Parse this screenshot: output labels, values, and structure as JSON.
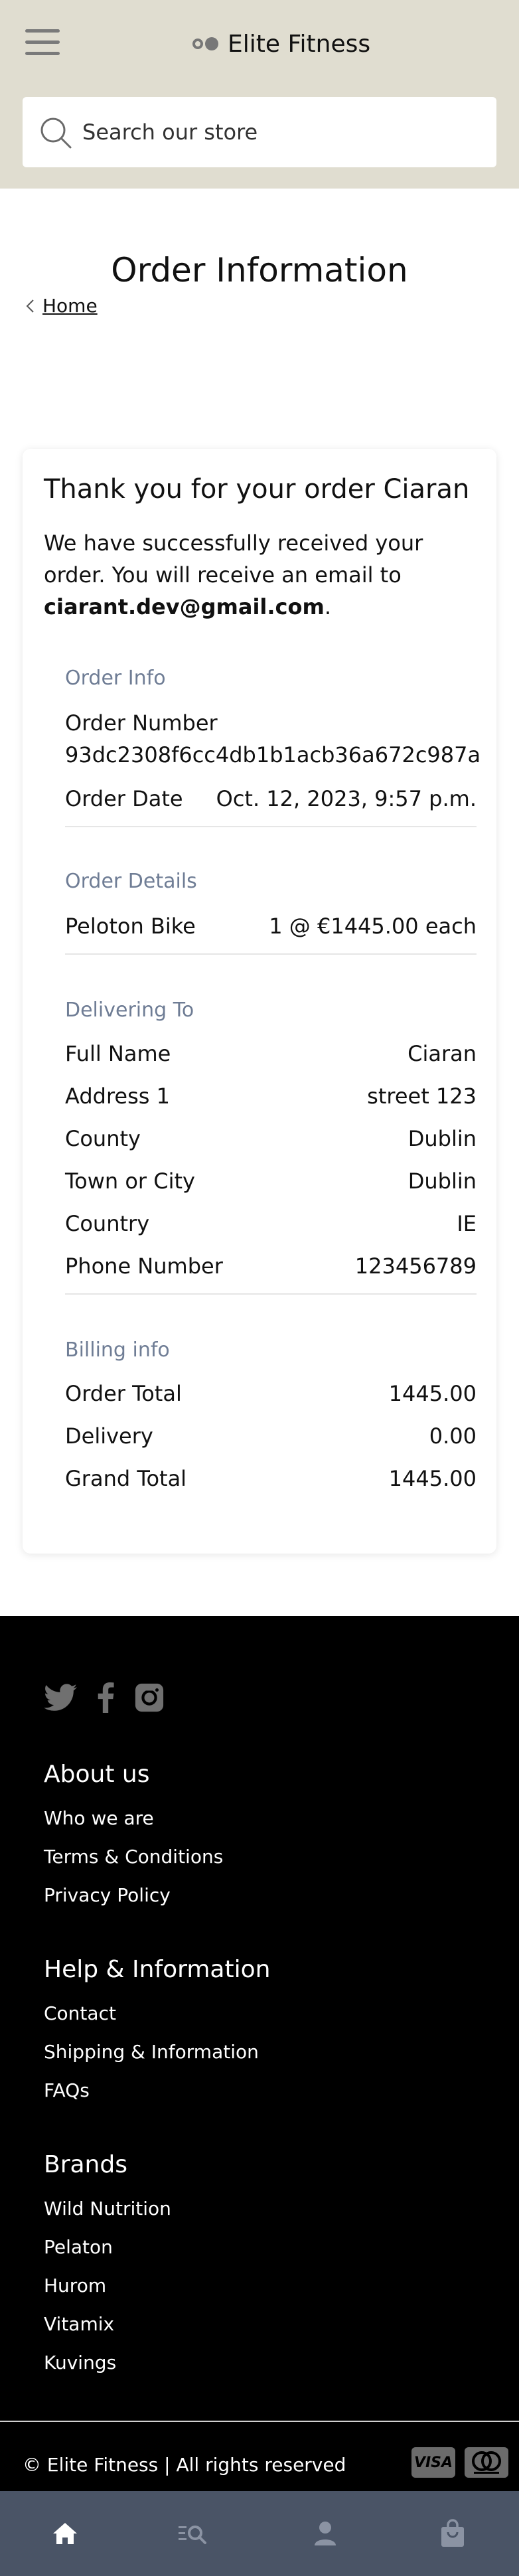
{
  "header": {
    "brand": "Elite Fitness",
    "search_placeholder": "Search our store"
  },
  "page": {
    "title": "Order Information",
    "breadcrumb_home": "Home"
  },
  "order": {
    "thanks": "Thank you for your order Ciaran",
    "message_prefix": "We have successfully received your order. You will receive an email to ",
    "email": "ciarant.dev@gmail.com",
    "message_suffix": ".",
    "order_info": {
      "title": "Order Info",
      "number_label": "Order Number",
      "number_value": "93dc2308f6cc4db1b1acb36a672c987a",
      "date_label": "Order Date",
      "date_value": "Oct. 12, 2023, 9:57 p.m."
    },
    "order_details": {
      "title": "Order Details",
      "item_name": "Peloton Bike",
      "item_qty": "1 @ €1445.00 each"
    },
    "delivering_to": {
      "title": "Delivering To",
      "rows": [
        {
          "label": "Full Name",
          "value": "Ciaran"
        },
        {
          "label": "Address 1",
          "value": "street 123"
        },
        {
          "label": "County",
          "value": "Dublin"
        },
        {
          "label": "Town or City",
          "value": "Dublin"
        },
        {
          "label": "Country",
          "value": "IE"
        },
        {
          "label": "Phone Number",
          "value": "123456789"
        }
      ]
    },
    "billing": {
      "title": "Billing info",
      "rows": [
        {
          "label": "Order Total",
          "value": "1445.00"
        },
        {
          "label": "Delivery",
          "value": "0.00"
        },
        {
          "label": "Grand Total",
          "value": "1445.00"
        }
      ]
    }
  },
  "footer": {
    "about": {
      "title": "About us",
      "links": [
        "Who we are",
        "Terms & Conditions",
        "Privacy Policy"
      ]
    },
    "help": {
      "title": "Help & Information",
      "links": [
        "Contact",
        "Shipping & Information",
        "FAQs"
      ]
    },
    "brands": {
      "title": "Brands",
      "links": [
        "Wild Nutrition",
        "Pelaton",
        "Hurom",
        "Vitamix",
        "Kuvings"
      ]
    },
    "copyright": "© Elite Fitness | All rights reserved",
    "visa": "VISA",
    "social_icons": [
      "twitter-icon",
      "facebook-icon",
      "instagram-icon"
    ]
  },
  "bottom_nav": {
    "icons": [
      "home-icon",
      "search-list-icon",
      "account-icon",
      "bag-icon"
    ]
  },
  "colors": {
    "header_bg": "#e0ddd0",
    "section_title": "#6f7d95",
    "footer_bg": "#000000",
    "nav_bg": "#4a5466"
  }
}
